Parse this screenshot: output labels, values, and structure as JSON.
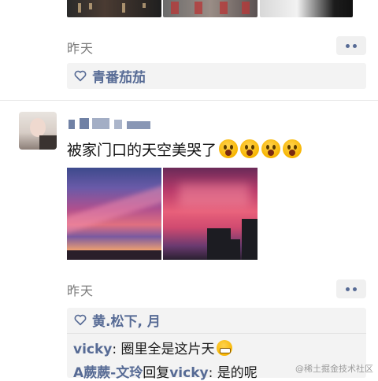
{
  "feed": {
    "post_previous": {
      "time": "昨天",
      "likes": "青番茄茄"
    },
    "post_current": {
      "username": "■ ▇ ▖ 文良",
      "text": "被家门口的天空美哭了",
      "emoji_count": 4,
      "time": "昨天",
      "likes": "黄.松下, 月",
      "comments": [
        {
          "author": "vicky",
          "separator": ": ",
          "text": "圈里全是这片天",
          "emoji": "grinning-face"
        },
        {
          "author": "A蕨蕨-文玲",
          "reply_word": "回复",
          "reply_to": "vicky",
          "separator": ": ",
          "text": "是的呢"
        }
      ]
    }
  },
  "watermark": "@稀土掘金技术社区",
  "colors": {
    "link": "#576b95",
    "like_box": "#f3f3f3",
    "time": "#7a7a7a"
  }
}
